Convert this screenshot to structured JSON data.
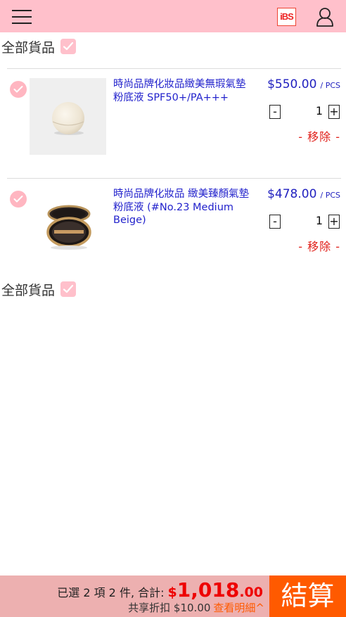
{
  "header": {
    "logo_text": "iBS",
    "icons": [
      "menu-icon",
      "user-icon"
    ]
  },
  "select_all_label": "全部貨品",
  "items": [
    {
      "name": "時尚品牌化妝品緻美無瑕氣墊粉底液 SPF50+/PA+++",
      "price": "$550.00",
      "unit": "/ PCS",
      "qty": "1",
      "minus": "-",
      "plus": "+",
      "remove": "- 移除 -",
      "selected": true
    },
    {
      "name": "時尚品牌化妝品 緻美臻顏氣墊粉底液 (#No.23 Medium Beige)",
      "price": "$478.00",
      "unit": "/ PCS",
      "qty": "1",
      "minus": "-",
      "plus": "+",
      "remove": "- 移除 -",
      "selected": true
    }
  ],
  "footer": {
    "summary_prefix": "已選 2 項 2 件, 合計:",
    "currency": "$",
    "total_main": "1,018",
    "total_decimal": ".00",
    "discount_text": "共享折扣 $10.00",
    "view_detail": "查看明細^",
    "checkout": "結算"
  },
  "colors": {
    "header_bg": "#ffc0cb",
    "checkbox_pink": "#ffc0cb",
    "link_blue": "#2222cc",
    "remove_red": "#e0201a",
    "checkout_orange": "#ff5a00",
    "footer_bg": "#edb0b0"
  }
}
